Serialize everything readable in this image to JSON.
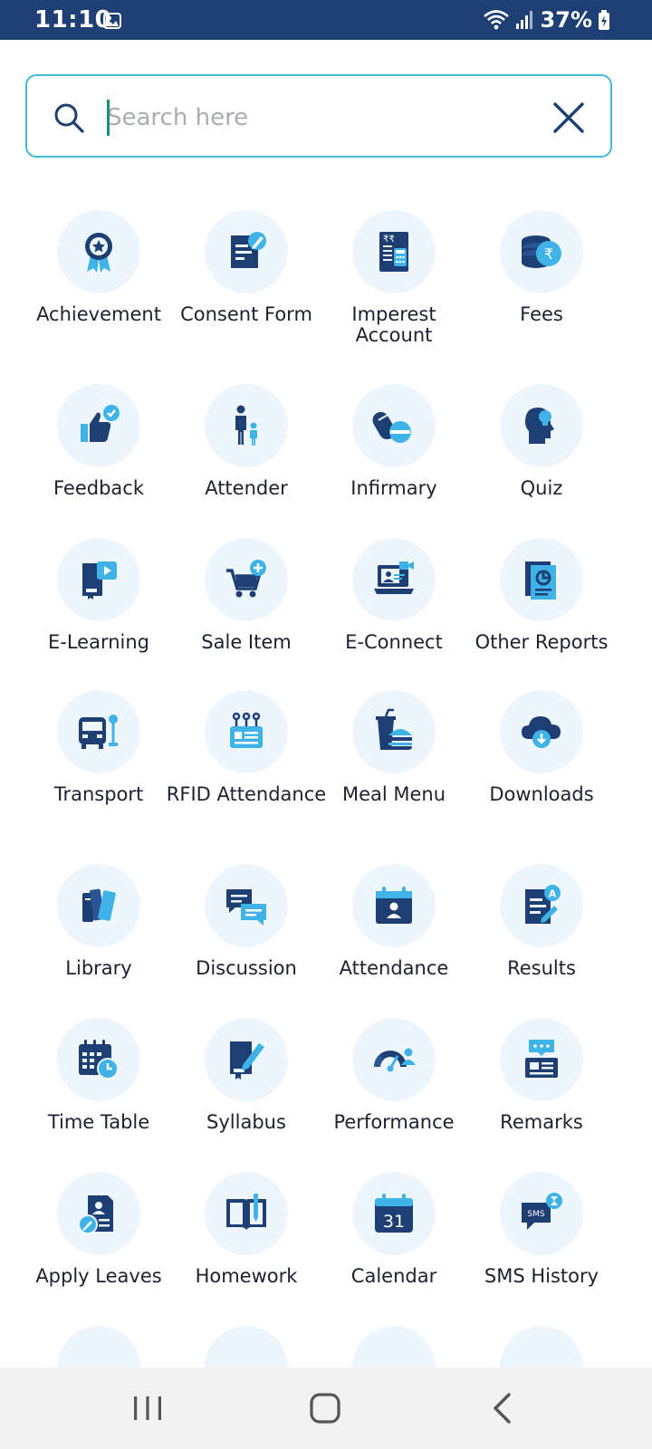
{
  "status_bar": {
    "time": "11:10",
    "battery": "37%"
  },
  "search": {
    "placeholder": "Search here",
    "value": ""
  },
  "modules": [
    {
      "label": "Achievement",
      "icon": "award-ribbon-icon"
    },
    {
      "label": "Consent Form",
      "icon": "signed-document-icon"
    },
    {
      "label": "Imperest Account",
      "icon": "rupee-calculator-icon"
    },
    {
      "label": "Fees",
      "icon": "coins-rupee-icon"
    },
    {
      "label": "Feedback",
      "icon": "thumbs-up-check-icon"
    },
    {
      "label": "Attender",
      "icon": "parent-child-icon"
    },
    {
      "label": "Infirmary",
      "icon": "pills-icon"
    },
    {
      "label": "Quiz",
      "icon": "head-bulb-icon"
    },
    {
      "label": "E-Learning",
      "icon": "book-video-icon"
    },
    {
      "label": "Sale Item",
      "icon": "cart-plus-icon"
    },
    {
      "label": "E-Connect",
      "icon": "laptop-video-call-icon"
    },
    {
      "label": "Other Reports",
      "icon": "report-chart-icon"
    },
    {
      "label": "Transport",
      "icon": "bus-stop-icon"
    },
    {
      "label": "RFID Attendance",
      "icon": "rfid-card-icon"
    },
    {
      "label": "Meal Menu",
      "icon": "burger-drink-icon"
    },
    {
      "label": "Downloads",
      "icon": "cloud-download-icon"
    },
    {
      "label": "Library",
      "icon": "books-icon"
    },
    {
      "label": "Discussion",
      "icon": "chat-bubbles-icon"
    },
    {
      "label": "Attendance",
      "icon": "calendar-person-icon"
    },
    {
      "label": "Results",
      "icon": "grade-sheet-icon"
    },
    {
      "label": "Time Table",
      "icon": "calendar-clock-icon"
    },
    {
      "label": "Syllabus",
      "icon": "book-pencil-icon"
    },
    {
      "label": "Performance",
      "icon": "gauge-person-icon"
    },
    {
      "label": "Remarks",
      "icon": "comment-board-icon"
    },
    {
      "label": "Apply Leaves",
      "icon": "leave-form-icon"
    },
    {
      "label": "Homework",
      "icon": "open-book-pen-icon"
    },
    {
      "label": "Calendar",
      "icon": "calendar-31-icon"
    },
    {
      "label": "SMS History",
      "icon": "sms-history-icon"
    }
  ],
  "calendar_day": "31",
  "sms_badge": "SMS",
  "colors": {
    "status_bar": "#1e3f73",
    "icon_dark": "#1e3f73",
    "icon_light": "#3fb3e8",
    "tile_bg": "#eef6fd",
    "search_border": "#45b8d6"
  }
}
